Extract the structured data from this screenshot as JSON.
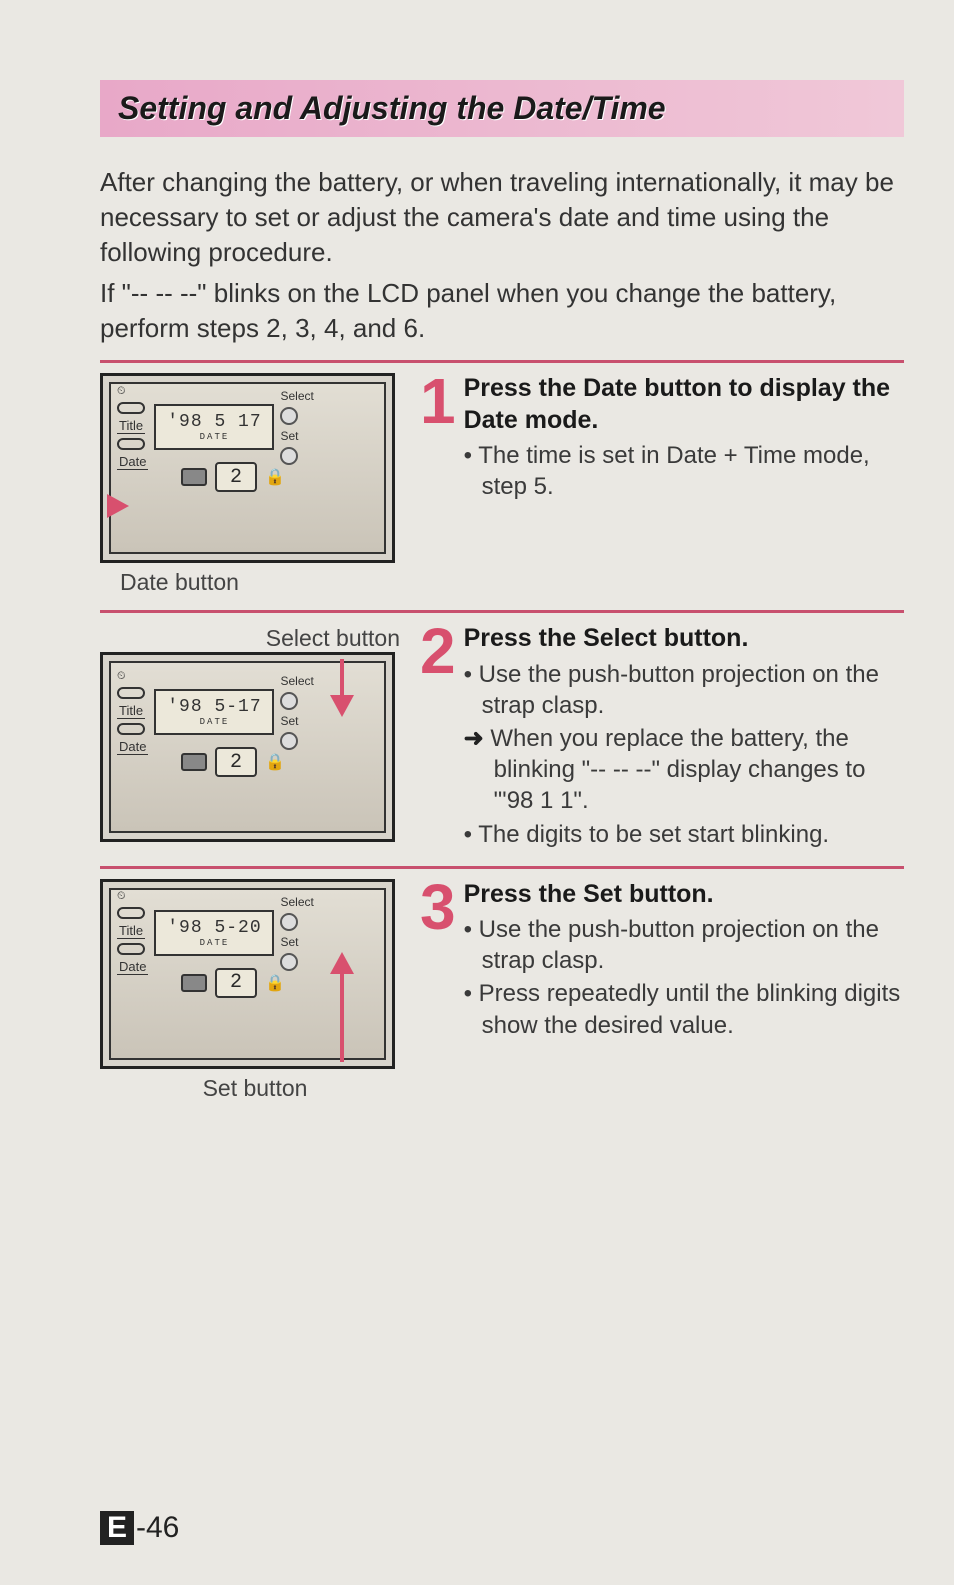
{
  "page": {
    "title": "Setting and Adjusting the Date/Time",
    "intro_plain": "After changing the battery, or when traveling internationally, it may be necessary to set or adjust the camera's date and time using the following procedure.",
    "intro_bold": "If \"-- -- --\" blinks on the LCD panel when you change the battery, perform steps 2, 3, 4, and 6.",
    "page_number_prefix": "E",
    "page_number": "-46"
  },
  "steps": [
    {
      "num": "1",
      "title": "Press the Date button to display the Date mode.",
      "bullets": [
        "The time is set in Date + Time mode, step 5."
      ],
      "arrows": [],
      "figure_caption": "Date button",
      "caption_pos": "left",
      "lcd_main": "'98  5  17",
      "lcd_sub": "DATE",
      "counter": "2",
      "pointer_label": ""
    },
    {
      "num": "2",
      "title": "Press the Select button.",
      "bullets": [
        "Use the push-button projection on the strap clasp."
      ],
      "arrows": [
        "When you replace the battery, the blinking \"-- -- --\" display changes to \"'98 1 1\"."
      ],
      "bullets_after": [
        "The digits to be set start blinking."
      ],
      "figure_caption": "Select button",
      "caption_pos": "right-top",
      "lcd_main": "'98  5-17",
      "lcd_sub": "DATE",
      "counter": "2",
      "pointer_label": ""
    },
    {
      "num": "3",
      "title": "Press the Set button.",
      "bullets": [
        "Use the push-button projection on the strap clasp.",
        "Press repeatedly until the blinking digits show the desired value."
      ],
      "arrows": [],
      "figure_caption": "Set button",
      "caption_pos": "center-bottom",
      "lcd_main": "'98  5-20",
      "lcd_sub": "DATE",
      "counter": "2",
      "pointer_label": ""
    }
  ],
  "diagram_labels": {
    "select": "Select",
    "set": "Set",
    "title_btn": "Title",
    "date_btn": "Date",
    "timer_icon": "⏲"
  }
}
